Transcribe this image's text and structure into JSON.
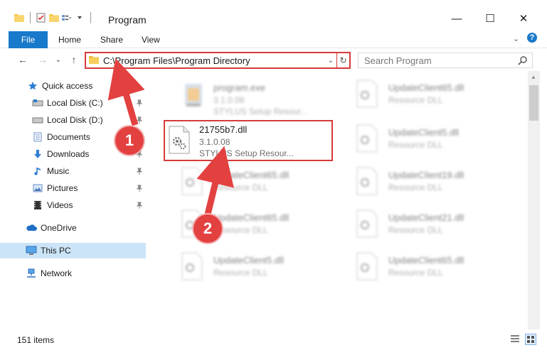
{
  "window": {
    "title": "Program",
    "minimize": "—",
    "maximize": "☐",
    "close": "✕"
  },
  "ribbon": {
    "file": "File",
    "home": "Home",
    "share": "Share",
    "view": "View",
    "expand": "⌄",
    "help": "?"
  },
  "nav": {
    "back": "←",
    "forward": "→",
    "recent": "⌄",
    "up": "↑"
  },
  "address": {
    "path": "C:\\Program Files\\Program Directory",
    "dropdown": "⌄",
    "refresh": "↻"
  },
  "search": {
    "placeholder": "Search Program"
  },
  "sidebar": {
    "items": [
      {
        "label": "Quick access",
        "icon": "star-icon",
        "pinned": false
      },
      {
        "label": "Local Disk (C:)",
        "icon": "drive-icon",
        "pinned": true
      },
      {
        "label": "Local Disk (D:)",
        "icon": "drive-icon",
        "pinned": true
      },
      {
        "label": "Documents",
        "icon": "documents-icon",
        "pinned": true
      },
      {
        "label": "Downloads",
        "icon": "downloads-icon",
        "pinned": true
      },
      {
        "label": "Music",
        "icon": "music-icon",
        "pinned": true
      },
      {
        "label": "Pictures",
        "icon": "pictures-icon",
        "pinned": true
      },
      {
        "label": "Videos",
        "icon": "videos-icon",
        "pinned": true
      },
      {
        "label": "OneDrive",
        "icon": "cloud-icon",
        "pinned": false
      },
      {
        "label": "This PC",
        "icon": "computer-icon",
        "pinned": false,
        "selected": true
      },
      {
        "label": "Network",
        "icon": "network-icon",
        "pinned": false
      }
    ]
  },
  "files": {
    "left": [
      {
        "name": "program.exe",
        "line1": "3.1.0.08",
        "line2": "STYLUS Setup Resour...",
        "type": "exe",
        "blurred": true
      },
      {
        "name": "21755b7.dll",
        "line1": "3.1.0.08",
        "line2": "STYLUS Setup Resour...",
        "type": "dll",
        "blurred": false,
        "highlighted": true
      },
      {
        "name": "UpdateClient65.dll",
        "line1": "Resource DLL",
        "type": "dll",
        "blurred": true
      },
      {
        "name": "UpdateClient65.dll",
        "line1": "Resource DLL",
        "type": "dll",
        "blurred": true
      },
      {
        "name": "UpdateClient5.dll",
        "line1": "Resource DLL",
        "type": "dll",
        "blurred": true
      }
    ],
    "right": [
      {
        "name": "UpdateClient65.dll",
        "line1": "Resource DLL",
        "type": "dll",
        "blurred": true
      },
      {
        "name": "UpdateClient5.dll",
        "line1": "Resource DLL",
        "type": "dll",
        "blurred": true
      },
      {
        "name": "UpdateClient19.dll",
        "line1": "Resource DLL",
        "type": "dll",
        "blurred": true
      },
      {
        "name": "UpdateClient21.dll",
        "line1": "Resource DLL",
        "type": "dll",
        "blurred": true
      },
      {
        "name": "UpdateClient65.dll",
        "line1": "Resource DLL",
        "type": "dll",
        "blurred": true
      }
    ]
  },
  "annotations": {
    "step1": "1",
    "step2": "2"
  },
  "status": {
    "count": "151 items"
  },
  "colors": {
    "accent": "#1979ca",
    "annotation": "#e34040",
    "selected": "#cce4f7"
  }
}
